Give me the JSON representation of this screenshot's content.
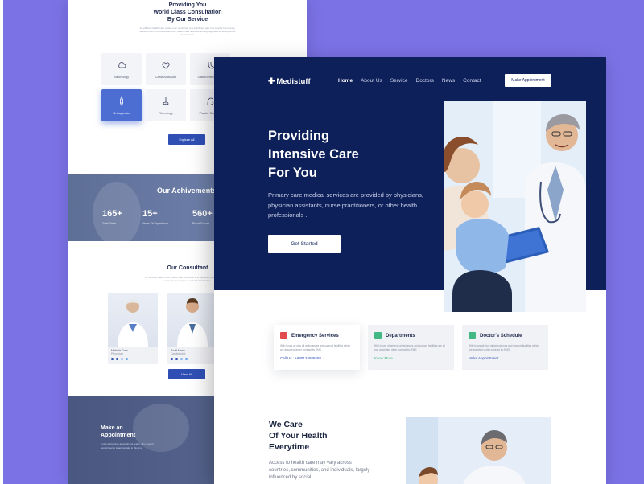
{
  "back_page": {
    "service_title": "Providing You\nWorld Class Consultation\nBy Our Service",
    "service_desc": "An efficient health care system can contribute to a significant part of a country's economy, development and industrialization. Health care is conventionally regarded as an important determinant.",
    "services": [
      {
        "label": "Neurology",
        "icon": "brain-icon"
      },
      {
        "label": "Cardiovascular",
        "icon": "heart-icon"
      },
      {
        "label": "Gastroenterology",
        "icon": "stomach-icon"
      },
      {
        "label": "Orthopedics",
        "icon": "bone-icon",
        "active": true
      },
      {
        "label": "Rhinology",
        "icon": "nose-icon"
      },
      {
        "label": "Plastic Surgery",
        "icon": "face-icon"
      }
    ],
    "explore_label": "Explore All",
    "achievement_title": "Our Achivements",
    "achievements": [
      {
        "value": "165+",
        "label": "Total Staffs"
      },
      {
        "value": "15+",
        "label": "Years Of Experience"
      },
      {
        "value": "560+",
        "label": "Blood Donors"
      }
    ],
    "consultant_title": "Our Consultant",
    "consultant_desc": "An efficient health care system can contribute to a significant part of a country's economy, development and industrialization.",
    "consultants": [
      {
        "name": "Michale Corn",
        "role": "Physician"
      },
      {
        "name": "Scott Mane",
        "role": "Cardiologist"
      }
    ],
    "view_all_label": "View All",
    "appointment_title": "Make an\nAppointment",
    "appointment_desc": "In the doctor-free appointment realm, why doesn't appointments is appropriate in this time"
  },
  "front_page": {
    "logo": "Medistuff",
    "nav": [
      "Home",
      "About Us",
      "Service",
      "Doctors",
      "News",
      "Contact"
    ],
    "make_appointment": "Make Appointment",
    "hero_title": "Providing\nIntensive Care\nFor You",
    "hero_desc": "Primary care medical services are provided by physicians, physician assistants, nurse practitioners, or other health professionals .",
    "get_started": "Get Started",
    "features": [
      {
        "title": "Emergency Services",
        "desc": "With hours all plus all ambulances and support facilities which are assorted under contract by EMS",
        "link": "Call Us : +880124589458",
        "icon": "ambulance-icon",
        "color": "#e24b4b",
        "link_color": "#2f4fb5"
      },
      {
        "title": "Departments",
        "desc": "With hours of general ambulances and support facilities are all you appointed other contract by EMS",
        "link": "Know More",
        "icon": "building-icon",
        "color": "#43b884",
        "link_color": "#43b884"
      },
      {
        "title": "Doctor's Schedule",
        "desc": "With hours all plus all ambulances and support facilities which are assorted under contract by EMS",
        "link": "Make Appointment",
        "icon": "calendar-icon",
        "color": "#43b884",
        "link_color": "#2f4fb5"
      }
    ],
    "care_title": "We Care\nOf Your Health\nEverytime",
    "care_desc": "Access to health care may vary across countries, communities, and individuals, largely influenced by social."
  },
  "colors": {
    "navy": "#0e2059",
    "purple_bg": "#7b72e6",
    "accent_blue": "#2f4fb5",
    "green": "#43b884",
    "red": "#e24b4b"
  }
}
